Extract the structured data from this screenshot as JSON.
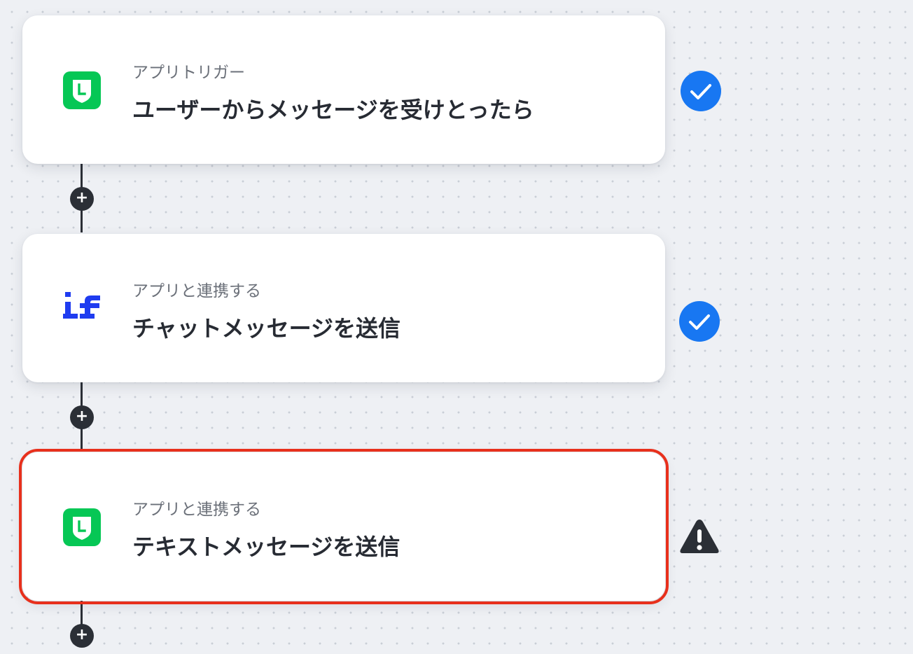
{
  "colors": {
    "canvas_background": "#eef0f4",
    "line_brand_green": "#06c755",
    "if_brand_blue": "#1f3cf0",
    "status_complete_blue": "#1877f2",
    "selected_outline_red": "#e8301c",
    "warning_dark": "#2b2f36"
  },
  "flow": {
    "steps": [
      {
        "subtitle": "アプリトリガー",
        "title": "ユーザーからメッセージを受けとったら",
        "app_icon": "line-app-icon",
        "status": "complete",
        "status_icon": "checkmark-circle-icon"
      },
      {
        "subtitle": "アプリと連携する",
        "title": "チャットメッセージを送信",
        "app_icon": "if-app-icon",
        "status": "complete",
        "status_icon": "checkmark-circle-icon"
      },
      {
        "subtitle": "アプリと連携する",
        "title": "テキストメッセージを送信",
        "app_icon": "line-app-icon",
        "status": "warning",
        "status_icon": "warning-triangle-icon",
        "selected": true
      }
    ],
    "add_step_icon": "plus-icon"
  }
}
